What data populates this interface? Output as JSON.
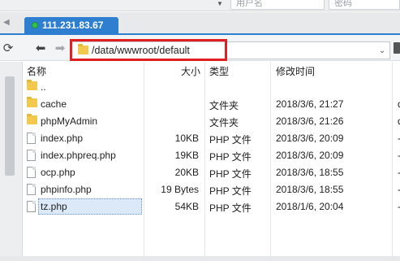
{
  "top": {
    "dropdown_icon": "chevron-down-icon",
    "username_placeholder": "用户名",
    "password_placeholder": "密码"
  },
  "tab": {
    "title": "111.231.83.67",
    "status_color": "#36c24a",
    "accent": "#2e7fd0"
  },
  "toolbar": {
    "path": "/data/wwwroot/default",
    "icons": [
      "refresh-icon",
      "back-arrow-icon",
      "forward-arrow-icon",
      "folder-icon",
      "chevron-down-icon"
    ]
  },
  "columns": {
    "name": "名称",
    "size": "大小",
    "type": "类型",
    "modified": "修改时间"
  },
  "files": [
    {
      "name": "..",
      "icon": "folder",
      "size": "",
      "type": "",
      "modified": "",
      "perm": ""
    },
    {
      "name": "cache",
      "icon": "folder",
      "size": "",
      "type": "文件夹",
      "modified": "2018/3/6, 21:27",
      "perm": "d"
    },
    {
      "name": "phpMyAdmin",
      "icon": "folder",
      "size": "",
      "type": "文件夹",
      "modified": "2018/3/6, 21:26",
      "perm": "d"
    },
    {
      "name": "index.php",
      "icon": "file",
      "size": "10KB",
      "type": "PHP 文件",
      "modified": "2018/3/6, 20:09",
      "perm": "-"
    },
    {
      "name": "index.phpreq.php",
      "icon": "file",
      "size": "19KB",
      "type": "PHP 文件",
      "modified": "2018/3/6, 20:09",
      "perm": "-"
    },
    {
      "name": "ocp.php",
      "icon": "file",
      "size": "20KB",
      "type": "PHP 文件",
      "modified": "2018/3/6, 18:55",
      "perm": "-"
    },
    {
      "name": "phpinfo.php",
      "icon": "file",
      "size": "19 Bytes",
      "type": "PHP 文件",
      "modified": "2018/3/6, 18:55",
      "perm": "-"
    },
    {
      "name": "tz.php",
      "icon": "file",
      "size": "54KB",
      "type": "PHP 文件",
      "modified": "2018/1/6, 20:04",
      "perm": "-"
    }
  ],
  "selected_file": "tz.php",
  "highlight_color": "#e02020"
}
